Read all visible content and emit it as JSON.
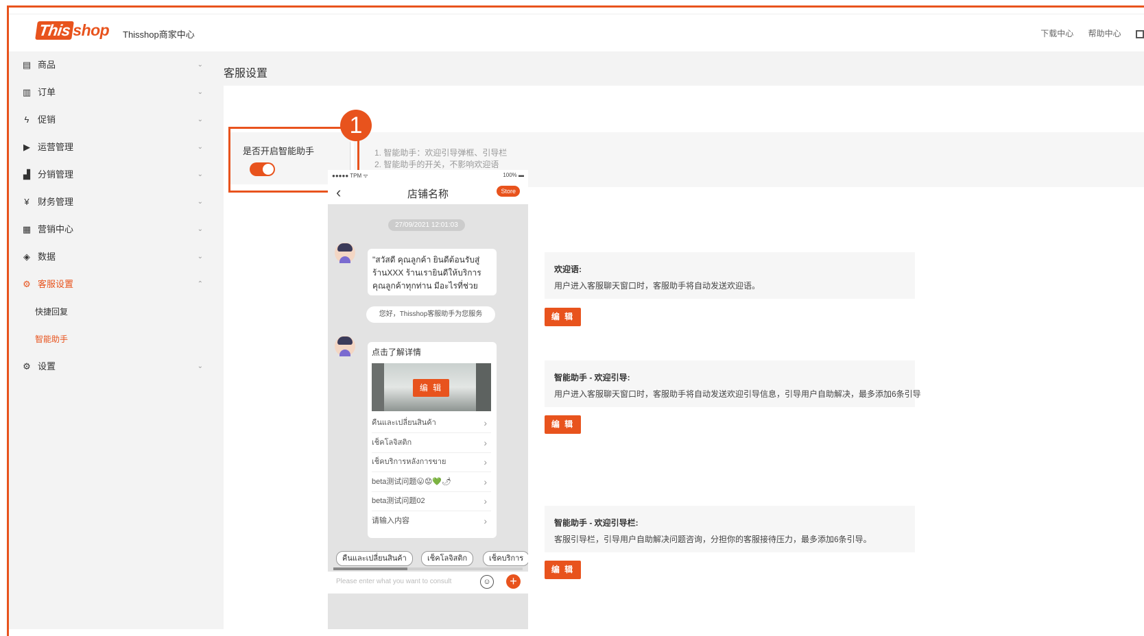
{
  "topbar": {
    "logo_left": "This",
    "logo_right": "shop",
    "title": "Thisshop商家中心",
    "links": [
      "下载中心",
      "帮助中心"
    ]
  },
  "sidebar": {
    "items": [
      {
        "label": "商品",
        "icon": "store-icon",
        "glyph": "▤"
      },
      {
        "label": "订单",
        "icon": "order-icon",
        "glyph": "▥"
      },
      {
        "label": "促销",
        "icon": "lightning-icon",
        "glyph": "ϟ"
      },
      {
        "label": "运营管理",
        "icon": "play-icon",
        "glyph": "▶"
      },
      {
        "label": "分销管理",
        "icon": "chart-icon",
        "glyph": "▟"
      },
      {
        "label": "财务管理",
        "icon": "finance-icon",
        "glyph": "¥"
      },
      {
        "label": "营销中心",
        "icon": "calendar-icon",
        "glyph": "▦"
      },
      {
        "label": "数据",
        "icon": "shield-icon",
        "glyph": "◈"
      },
      {
        "label": "客服设置",
        "icon": "gear-icon",
        "glyph": "⚙"
      },
      {
        "label": "设置",
        "icon": "gear-icon",
        "glyph": "⚙"
      }
    ],
    "sub_items": [
      "快捷回复",
      "智能助手"
    ]
  },
  "page": {
    "title": "客服设置",
    "toggle_label": "是否开启智能助手",
    "toggle_on": true,
    "step_badge": "1",
    "info_line1": "1. 智能助手：欢迎引导弹框、引导栏",
    "info_line2": "2. 智能助手的开关，不影响欢迎语"
  },
  "phone": {
    "status_left": "●●●●● TPM ᯤ",
    "status_right": "100% ▬",
    "title": "店铺名称",
    "store_badge": "Store",
    "date": "27/09/2021 12:01:03",
    "greeting": "\"สวัสดี คุณลูกค้า ยินดีต้อนรับสู่ร้านXXX ร้านเรายินดีให้บริการคุณลูกค้าทุกท่าน มีอะไรที่ช่วยคุณ...",
    "auto_reply": "您好，Thisshop客服助手为您服务",
    "card_title": "点击了解详情",
    "card_edit": "编 辑",
    "rows": [
      "คืนและเปลี่ยนสินค้า",
      "เช็คโลจิสติก",
      "เช็คบริการหลังการขาย",
      "beta测试问题😛😟💚🌶",
      "beta测试问题02",
      "请输入内容"
    ],
    "quick_chips": [
      "คืนและเปลี่ยนสินค้า",
      "เช็คโลจิสติก",
      "เช็คบริการ"
    ],
    "input_placeholder": "Please enter what you want to consult"
  },
  "config": {
    "welcome": {
      "title": "欢迎语:",
      "desc": "用户进入客服聊天窗口时，客服助手将自动发送欢迎语。"
    },
    "guide": {
      "title": "智能助手 - 欢迎引导:",
      "desc": "用户进入客服聊天窗口时，客服助手将自动发送欢迎引导信息，引导用户自助解决，最多添加6条引导"
    },
    "guide_bar": {
      "title": "智能助手 - 欢迎引导栏:",
      "desc": "客服引导栏，引导用户自助解决问题咨询，分担你的客服接待压力，最多添加6条引导。"
    },
    "edit_label": "编 辑"
  },
  "colors": {
    "accent": "#e8531d",
    "sidebar_bg": "#f3f3f3"
  }
}
